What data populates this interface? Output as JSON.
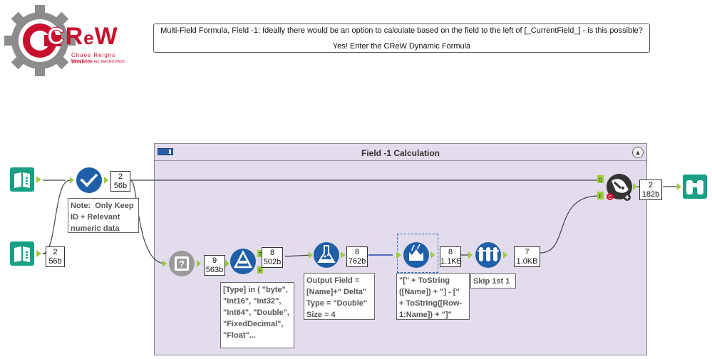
{
  "logo": {
    "letters": "CReW",
    "tagline": "Chaos Reigns Within",
    "subtagline": "A FREE-FOR-ALL MACRO PACK"
  },
  "comment": {
    "line1": "Multi-Field Formula, Field -1:  Ideally there would be an option to calculate based on the field to the left of [_CurrentField_] - is this possible?",
    "line2": "Yes!  Enter the CReW Dynamic Formula"
  },
  "container": {
    "title": "Field -1 Calculation"
  },
  "colors": {
    "input_tool": "#16a085",
    "filter_tool": "#1f5fa8",
    "container_bg": "#e2dcec"
  },
  "badges": {
    "input2": {
      "count": "2",
      "size": "56b"
    },
    "select": {
      "count": "2",
      "size": "56b"
    },
    "autofield": {
      "count": "9",
      "size": "563b"
    },
    "filter": {
      "count": "8",
      "size": "502b"
    },
    "formula": {
      "count": "8",
      "size": "762b"
    },
    "dynformula": {
      "count": "8",
      "size": "1.1KB"
    },
    "skip": {
      "count": "7",
      "size": "1.0KB"
    },
    "join": {
      "count": "2",
      "size": "182b"
    }
  },
  "notes": {
    "select": "Note:  Only Keep\nID + Relevant\nnumeric data",
    "filter": "[Type] in ( \"byte\",\n\"Int16\", \"Int32\",\n\"Int64\", \"Double\",\n\"FixedDecimal\",\n\"Float\"...",
    "formula": "Output Field =\n[Name]+\" Delta\"\nType = \"Double\"\nSize = 4",
    "dynformula": "\"[\" + ToString\n([Name]) + \"] - [\"\n+ ToString([Row-\n1:Name]) + \"]\"",
    "skip": "Skip 1st 1"
  },
  "anchors": {
    "filter_true": "T",
    "filter_false": "F",
    "join_d": "D",
    "join_f": "F"
  },
  "icons": {
    "input1": "book-input-icon",
    "input2": "book-input-icon",
    "select": "checkmark-select-icon",
    "autofield": "question-chip-icon",
    "filter": "filter-triangle-icon",
    "formula": "flask-formula-icon",
    "dynformula": "dynamic-formula-icon",
    "skip": "test-tubes-icon",
    "join": "append-badger-icon",
    "browse": "binoculars-icon"
  }
}
